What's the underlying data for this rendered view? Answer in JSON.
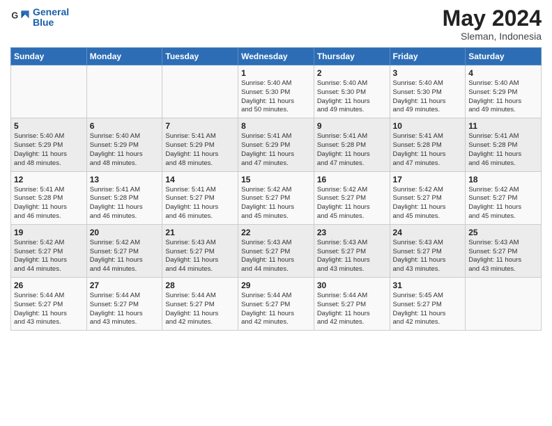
{
  "logo": {
    "line1": "General",
    "line2": "Blue"
  },
  "title": "May 2024",
  "location": "Sleman, Indonesia",
  "days_of_week": [
    "Sunday",
    "Monday",
    "Tuesday",
    "Wednesday",
    "Thursday",
    "Friday",
    "Saturday"
  ],
  "weeks": [
    [
      {
        "day": "",
        "info": ""
      },
      {
        "day": "",
        "info": ""
      },
      {
        "day": "",
        "info": ""
      },
      {
        "day": "1",
        "info": "Sunrise: 5:40 AM\nSunset: 5:30 PM\nDaylight: 11 hours\nand 50 minutes."
      },
      {
        "day": "2",
        "info": "Sunrise: 5:40 AM\nSunset: 5:30 PM\nDaylight: 11 hours\nand 49 minutes."
      },
      {
        "day": "3",
        "info": "Sunrise: 5:40 AM\nSunset: 5:30 PM\nDaylight: 11 hours\nand 49 minutes."
      },
      {
        "day": "4",
        "info": "Sunrise: 5:40 AM\nSunset: 5:29 PM\nDaylight: 11 hours\nand 49 minutes."
      }
    ],
    [
      {
        "day": "5",
        "info": "Sunrise: 5:40 AM\nSunset: 5:29 PM\nDaylight: 11 hours\nand 48 minutes."
      },
      {
        "day": "6",
        "info": "Sunrise: 5:40 AM\nSunset: 5:29 PM\nDaylight: 11 hours\nand 48 minutes."
      },
      {
        "day": "7",
        "info": "Sunrise: 5:41 AM\nSunset: 5:29 PM\nDaylight: 11 hours\nand 48 minutes."
      },
      {
        "day": "8",
        "info": "Sunrise: 5:41 AM\nSunset: 5:29 PM\nDaylight: 11 hours\nand 47 minutes."
      },
      {
        "day": "9",
        "info": "Sunrise: 5:41 AM\nSunset: 5:28 PM\nDaylight: 11 hours\nand 47 minutes."
      },
      {
        "day": "10",
        "info": "Sunrise: 5:41 AM\nSunset: 5:28 PM\nDaylight: 11 hours\nand 47 minutes."
      },
      {
        "day": "11",
        "info": "Sunrise: 5:41 AM\nSunset: 5:28 PM\nDaylight: 11 hours\nand 46 minutes."
      }
    ],
    [
      {
        "day": "12",
        "info": "Sunrise: 5:41 AM\nSunset: 5:28 PM\nDaylight: 11 hours\nand 46 minutes."
      },
      {
        "day": "13",
        "info": "Sunrise: 5:41 AM\nSunset: 5:28 PM\nDaylight: 11 hours\nand 46 minutes."
      },
      {
        "day": "14",
        "info": "Sunrise: 5:41 AM\nSunset: 5:27 PM\nDaylight: 11 hours\nand 46 minutes."
      },
      {
        "day": "15",
        "info": "Sunrise: 5:42 AM\nSunset: 5:27 PM\nDaylight: 11 hours\nand 45 minutes."
      },
      {
        "day": "16",
        "info": "Sunrise: 5:42 AM\nSunset: 5:27 PM\nDaylight: 11 hours\nand 45 minutes."
      },
      {
        "day": "17",
        "info": "Sunrise: 5:42 AM\nSunset: 5:27 PM\nDaylight: 11 hours\nand 45 minutes."
      },
      {
        "day": "18",
        "info": "Sunrise: 5:42 AM\nSunset: 5:27 PM\nDaylight: 11 hours\nand 45 minutes."
      }
    ],
    [
      {
        "day": "19",
        "info": "Sunrise: 5:42 AM\nSunset: 5:27 PM\nDaylight: 11 hours\nand 44 minutes."
      },
      {
        "day": "20",
        "info": "Sunrise: 5:42 AM\nSunset: 5:27 PM\nDaylight: 11 hours\nand 44 minutes."
      },
      {
        "day": "21",
        "info": "Sunrise: 5:43 AM\nSunset: 5:27 PM\nDaylight: 11 hours\nand 44 minutes."
      },
      {
        "day": "22",
        "info": "Sunrise: 5:43 AM\nSunset: 5:27 PM\nDaylight: 11 hours\nand 44 minutes."
      },
      {
        "day": "23",
        "info": "Sunrise: 5:43 AM\nSunset: 5:27 PM\nDaylight: 11 hours\nand 43 minutes."
      },
      {
        "day": "24",
        "info": "Sunrise: 5:43 AM\nSunset: 5:27 PM\nDaylight: 11 hours\nand 43 minutes."
      },
      {
        "day": "25",
        "info": "Sunrise: 5:43 AM\nSunset: 5:27 PM\nDaylight: 11 hours\nand 43 minutes."
      }
    ],
    [
      {
        "day": "26",
        "info": "Sunrise: 5:44 AM\nSunset: 5:27 PM\nDaylight: 11 hours\nand 43 minutes."
      },
      {
        "day": "27",
        "info": "Sunrise: 5:44 AM\nSunset: 5:27 PM\nDaylight: 11 hours\nand 43 minutes."
      },
      {
        "day": "28",
        "info": "Sunrise: 5:44 AM\nSunset: 5:27 PM\nDaylight: 11 hours\nand 42 minutes."
      },
      {
        "day": "29",
        "info": "Sunrise: 5:44 AM\nSunset: 5:27 PM\nDaylight: 11 hours\nand 42 minutes."
      },
      {
        "day": "30",
        "info": "Sunrise: 5:44 AM\nSunset: 5:27 PM\nDaylight: 11 hours\nand 42 minutes."
      },
      {
        "day": "31",
        "info": "Sunrise: 5:45 AM\nSunset: 5:27 PM\nDaylight: 11 hours\nand 42 minutes."
      },
      {
        "day": "",
        "info": ""
      }
    ]
  ]
}
